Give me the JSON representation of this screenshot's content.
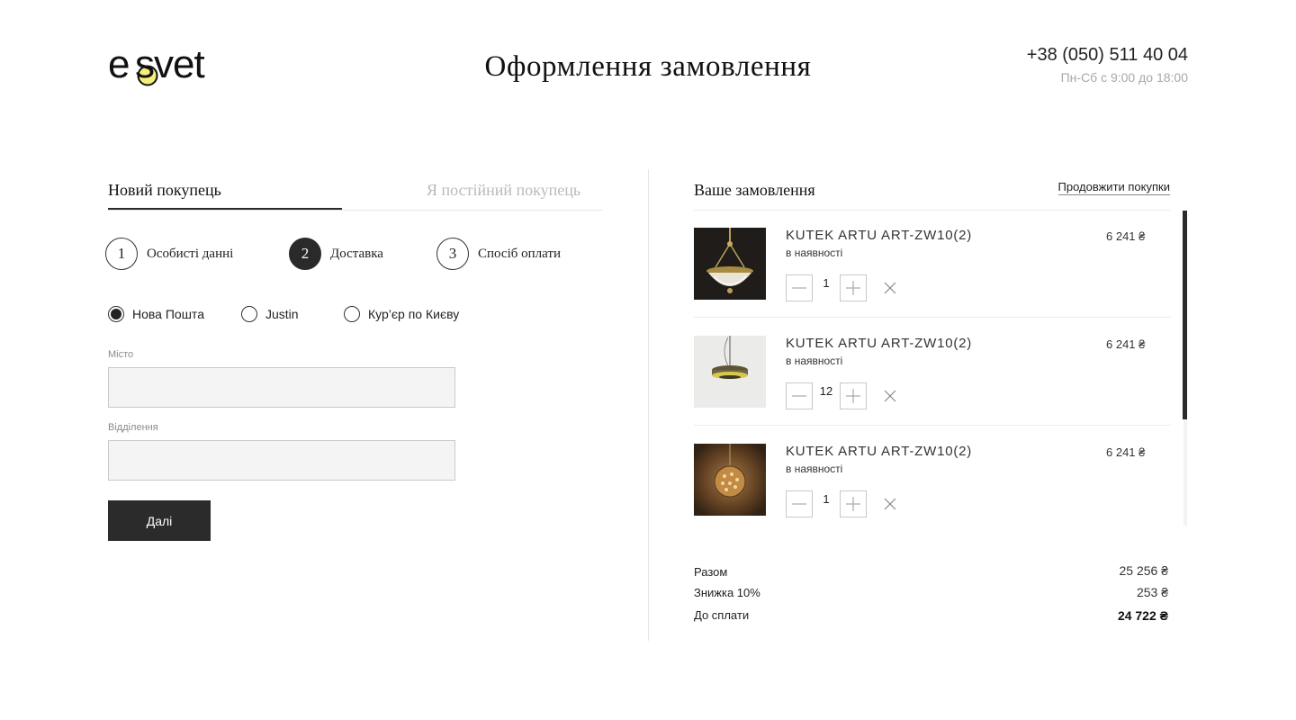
{
  "header": {
    "logo_text": "esvet",
    "title": "Оформлення замовлення",
    "phone": "+38 (050) 511 40 04",
    "hours": "Пн-Сб с 9:00 до 18:00"
  },
  "tabs": {
    "new_customer": "Новий покупець",
    "regular_customer": "Я постійний покупець"
  },
  "steps": [
    {
      "num": "1",
      "label": "Особисті данні",
      "active": false
    },
    {
      "num": "2",
      "label": "Доставка",
      "active": true
    },
    {
      "num": "3",
      "label": "Спосіб оплати",
      "active": false
    }
  ],
  "delivery": {
    "options": [
      {
        "label": "Нова Пошта",
        "checked": true
      },
      {
        "label": "Justin",
        "checked": false
      },
      {
        "label": "Кур’єр по Києву",
        "checked": false
      }
    ],
    "city_label": "Місто",
    "city_value": "",
    "branch_label": "Відділення",
    "branch_value": "",
    "next_button": "Далі"
  },
  "order": {
    "title": "Ваше замовлення",
    "continue_link": "Продовжити покупки",
    "items": [
      {
        "name": "KUTEK ARTU ART-ZW10(2)",
        "stock": "в наявності",
        "qty": "1",
        "price": "6 241 ₴"
      },
      {
        "name": "KUTEK ARTU ART-ZW10(2)",
        "stock": "в наявності",
        "qty": "12",
        "price": "6 241 ₴"
      },
      {
        "name": "KUTEK ARTU ART-ZW10(2)",
        "stock": "в наявності",
        "qty": "1",
        "price": "6 241 ₴"
      }
    ],
    "totals": {
      "subtotal_label": "Разом",
      "subtotal_value": "25 256 ₴",
      "discount_label": "Знижка 10%",
      "discount_value": "253 ₴",
      "total_label": "До сплати",
      "total_value": "24 722 ₴"
    }
  },
  "colors": {
    "dark": "#2b2b2b",
    "logo_accent": "#f5ee7a",
    "muted": "#b9b9b9",
    "field_bg": "#f4f4f4"
  },
  "icons": [
    "minus-icon",
    "plus-icon",
    "close-icon"
  ]
}
